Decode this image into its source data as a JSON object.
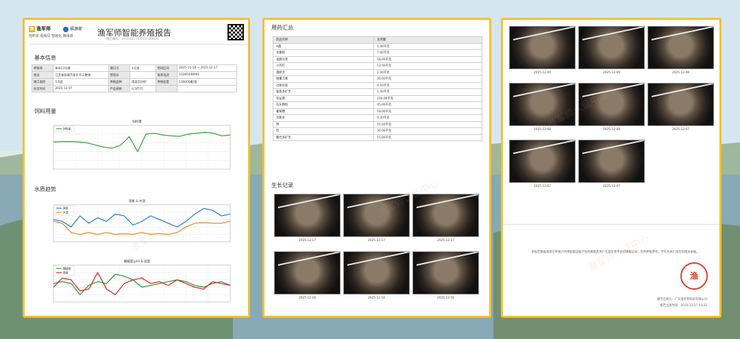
{
  "header": {
    "brand": "渔军师",
    "brand_icon": "渔",
    "partner": "福源家",
    "slogan": "控料定 看得见 智能化 降得准",
    "title": "渔军师智能养殖报告",
    "report_no": "报告编号：2025121703203789826"
  },
  "sections": {
    "basic": "基本信息",
    "feed": "饲料用量",
    "water": "水质趋势",
    "drug": "用药汇总",
    "growth": "生长记录"
  },
  "info_rows": [
    [
      "养殖场",
      "80413号塘",
      "塘口号",
      "1号池",
      "时间区间",
      "2025-11-18 ~ 2025-12-17"
    ],
    [
      "地址",
      "江苏省盐城市盐东市三墩线",
      "管理员",
      "",
      "联系电话",
      "15285448941"
    ],
    [
      "塘口面积",
      "5.6亩",
      "养殖品种",
      "南美白对虾",
      "养殖密度",
      "130000尾/亩"
    ],
    [
      "投苗时间",
      "2025-12-07",
      "产品规格",
      "0.5斤/只",
      "",
      ""
    ]
  ],
  "feed_chart_title": "饲料量",
  "feed_legend": "饲料量",
  "water_chart1_title": "溶氧 & 水温",
  "water_chart1_legend": [
    "溶氧",
    "水温"
  ],
  "water_chart2_title": "酸碱度(pH) & 盐度",
  "water_chart2_legend": [
    "酸碱度",
    "盐度"
  ],
  "chart_data": [
    {
      "type": "line",
      "title": "饲料量",
      "series": [
        {
          "name": "饲料量",
          "values": [
            0.62,
            0.63,
            0.63,
            0.62,
            0.6,
            0.55,
            0.5,
            0.48,
            0.55,
            0.74,
            0.4,
            0.8,
            0.82,
            0.78,
            0.76,
            0.75,
            0.8,
            0.82,
            0.84,
            0.82,
            0.76,
            0.78
          ]
        }
      ]
    },
    {
      "type": "line",
      "title": "溶氧 & 水温",
      "series": [
        {
          "name": "溶氧",
          "values": [
            0.6,
            0.55,
            0.4,
            0.7,
            0.5,
            0.65,
            0.55,
            0.75,
            0.7,
            0.45,
            0.55,
            0.7,
            0.6,
            0.5,
            0.4,
            0.55,
            0.75,
            0.9,
            0.85,
            0.7,
            0.75
          ]
        },
        {
          "name": "水温",
          "values": [
            0.55,
            0.5,
            0.25,
            0.2,
            0.25,
            0.2,
            0.25,
            0.2,
            0.22,
            0.2,
            0.25,
            0.2,
            0.22,
            0.2,
            0.25,
            0.4,
            0.5,
            0.52,
            0.5,
            0.5,
            0.55
          ]
        }
      ]
    },
    {
      "type": "line",
      "title": "酸碱度(pH) & 盐度",
      "series": [
        {
          "name": "酸碱度",
          "values": [
            0.5,
            0.55,
            0.5,
            0.2,
            0.45,
            0.55,
            0.5,
            0.75,
            0.7,
            0.6,
            0.4,
            0.45,
            0.5,
            0.55,
            0.6,
            0.55,
            0.45,
            0.4,
            0.5,
            0.55,
            0.45
          ]
        },
        {
          "name": "盐度",
          "values": [
            0.4,
            0.65,
            0.6,
            0.3,
            0.35,
            0.8,
            0.35,
            0.2,
            0.5,
            0.6,
            0.65,
            0.5,
            0.55,
            0.45,
            0.6,
            0.5,
            0.4,
            0.35,
            0.55,
            0.5,
            0.45
          ]
        }
      ]
    }
  ],
  "drug_table": {
    "headers": [
      "药品名称",
      "总用量"
    ],
    "rows": [
      [
        "A菌",
        "1.00千克"
      ],
      [
        "文康粉",
        "7.00千克"
      ],
      [
        "发酵豆浆",
        "18.00千克"
      ],
      [
        "小苏打",
        "13.50千克"
      ],
      [
        "菌肥济",
        "1.00千克"
      ],
      [
        "微量元素",
        "20.00千克"
      ],
      [
        "过氧化氢",
        "0.50千克"
      ],
      [
        "氨基多矿宝",
        "1.50千克"
      ],
      [
        "有益菌",
        "150.00千克"
      ],
      [
        "石灰颗粒",
        "45.00千克"
      ],
      [
        "葡萄糖",
        "18.00千克"
      ],
      [
        "双氧水",
        "0.30千克"
      ],
      [
        "钾",
        "15.00千克"
      ],
      [
        "硅",
        "30.00千克"
      ],
      [
        "螯合多矿宝",
        "15.00千克"
      ]
    ]
  },
  "growth_photos": [
    "2025-12-17",
    "2025-12-17",
    "2025-12-17",
    "2025-12-16",
    "2025-12-16",
    "2025-12-16"
  ],
  "page3_photos": [
    "2025-12-09",
    "2025-12-09",
    "2025-12-08",
    "2025-12-08",
    "2025-12-08",
    "2025-12-07",
    "2025-12-07",
    "2025-12-07"
  ],
  "footer": {
    "disclaimer": "本报告数据来源于养殖户所用智能设备产生的数据及用户在渔军师平台的填报记录，仅供养殖参考，不作为执行或合同相关依据。",
    "issuer": "报告出具方：广东渔军师科技有限公司",
    "issue_time": "报告出具时间：2025/12/17 03:32",
    "stamp_char": "渔"
  },
  "watermark": "渔军师认证中心",
  "colors": {
    "accent": "#f2c230",
    "feed": "#37a63a",
    "oxygen": "#2f7fd0",
    "temp": "#f08a24",
    "ph": "#2e9a3a",
    "salinity": "#d42c2c",
    "stamp": "#d8412f"
  }
}
